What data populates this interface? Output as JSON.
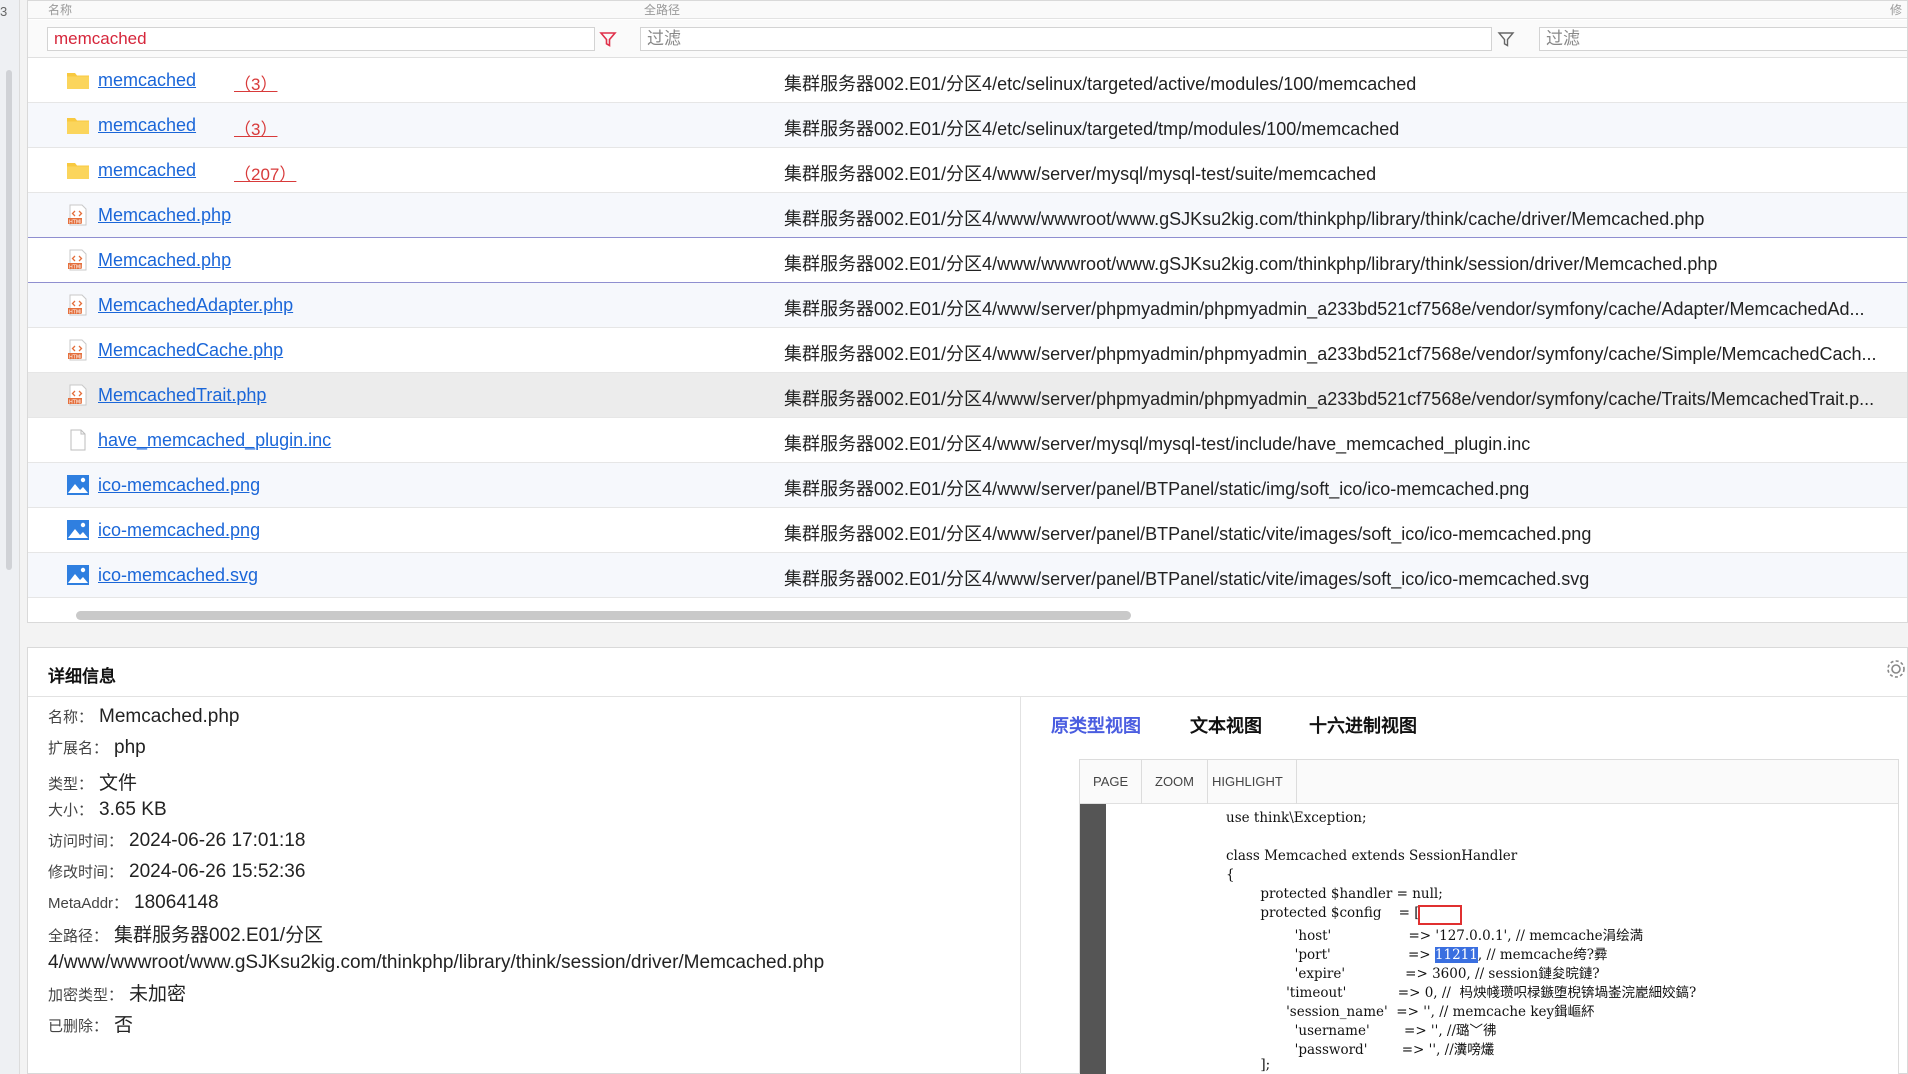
{
  "left_strip_mark": "3",
  "header": {
    "col1_label": "名称",
    "col2_label": "全路径",
    "col3_label": "修"
  },
  "filters": {
    "name_value": "memcached",
    "path_placeholder": "过滤",
    "third_placeholder": "过滤"
  },
  "rows": [
    {
      "name": "memcached",
      "count": "（3）",
      "type": "folder",
      "path": "集群服务器002.E01/分区4/etc/selinux/targeted/active/modules/100/memcached"
    },
    {
      "name": "memcached",
      "count": "（3）",
      "type": "folder",
      "path": "集群服务器002.E01/分区4/etc/selinux/targeted/tmp/modules/100/memcached"
    },
    {
      "name": "memcached",
      "count": "（207）",
      "type": "folder",
      "path": "集群服务器002.E01/分区4/www/server/mysql/mysql-test/suite/memcached"
    },
    {
      "name": "Memcached.php",
      "count": "",
      "type": "html",
      "path": "集群服务器002.E01/分区4/www/wwwroot/www.gSJKsu2kig.com/thinkphp/library/think/cache/driver/Memcached.php"
    },
    {
      "name": "Memcached.php",
      "count": "",
      "type": "html",
      "path": "集群服务器002.E01/分区4/www/wwwroot/www.gSJKsu2kig.com/thinkphp/library/think/session/driver/Memcached.php"
    },
    {
      "name": "MemcachedAdapter.php",
      "count": "",
      "type": "html",
      "path": "集群服务器002.E01/分区4/www/server/phpmyadmin/phpmyadmin_a233bd521cf7568e/vendor/symfony/cache/Adapter/MemcachedAd..."
    },
    {
      "name": "MemcachedCache.php",
      "count": "",
      "type": "html",
      "path": "集群服务器002.E01/分区4/www/server/phpmyadmin/phpmyadmin_a233bd521cf7568e/vendor/symfony/cache/Simple/MemcachedCach..."
    },
    {
      "name": "MemcachedTrait.php",
      "count": "",
      "type": "html",
      "path": "集群服务器002.E01/分区4/www/server/phpmyadmin/phpmyadmin_a233bd521cf7568e/vendor/symfony/cache/Traits/MemcachedTrait.p..."
    },
    {
      "name": "have_memcached_plugin.inc",
      "count": "",
      "type": "file",
      "path": "集群服务器002.E01/分区4/www/server/mysql/mysql-test/include/have_memcached_plugin.inc"
    },
    {
      "name": "ico-memcached.png",
      "count": "",
      "type": "image",
      "path": "集群服务器002.E01/分区4/www/server/panel/BTPanel/static/img/soft_ico/ico-memcached.png"
    },
    {
      "name": "ico-memcached.png",
      "count": "",
      "type": "image",
      "path": "集群服务器002.E01/分区4/www/server/panel/BTPanel/static/vite/images/soft_ico/ico-memcached.png"
    },
    {
      "name": "ico-memcached.svg",
      "count": "",
      "type": "image",
      "path": "集群服务器002.E01/分区4/www/server/panel/BTPanel/static/vite/images/soft_ico/ico-memcached.svg"
    }
  ],
  "details": {
    "title": "详细信息",
    "props": [
      {
        "key": "名称：",
        "value": "Memcached.php"
      },
      {
        "key": "扩展名：",
        "value": "php"
      },
      {
        "key": "类型：",
        "value": "文件"
      },
      {
        "key": "大小：",
        "value": "3.65 KB"
      },
      {
        "key": "访问时间：",
        "value": "2024-06-26 17:01:18"
      },
      {
        "key": "修改时间：",
        "value": "2024-06-26 15:52:36"
      },
      {
        "key": "MetaAddr：",
        "value": "18064148"
      },
      {
        "key": "全路径：",
        "value": "集群服务器002.E01/分区4/www/wwwroot/www.gSJKsu2kig.com/thinkphp/library/think/session/driver/Memcached.php"
      },
      {
        "key": "加密类型：",
        "value": "未加密"
      },
      {
        "key": "已删除：",
        "value": "否"
      }
    ],
    "tabs": [
      "原类型视图",
      "文本视图",
      "十六进制视图"
    ],
    "viewer_buttons": [
      "PAGE",
      "ZOOM",
      "HIGHLIGHT"
    ],
    "code_lines": [
      "use think\\Exception;",
      "",
      "class Memcached extends SessionHandler",
      "{",
      "        protected $handler = null;",
      "        protected $config    = [",
      "                'host'                  => '127.0.0.1', // memcache涓绘満",
      "                'port'                  =>",
      "                'expire'              => 3600, // session鏈夋晥鏈?",
      "              'timeout'            => 0, //  杩炴帴瓒呮椂鏃堕棿锛堝崟浣嶏細姣鎬?",
      "              'session_name'  => '', // memcache key鍓嶇紑",
      "                'username'        => '', //璐﹀彿",
      "                'password'        => '', //瀵嗙爜",
      "        ];"
    ],
    "highlight_value": "11211",
    "port_comment": ", // memcache绔?彛"
  }
}
